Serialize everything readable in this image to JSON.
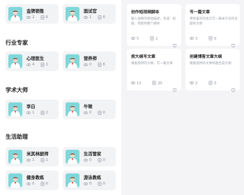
{
  "left": {
    "rows": [
      {
        "section": "",
        "cards": [
          {
            "name": "金牌销售",
            "v1": "2",
            "v2": "6"
          },
          {
            "name": "面试官",
            "v1": "1",
            "v2": "6"
          }
        ]
      },
      {
        "section": "行业专家",
        "cards": [
          {
            "name": "心理医生",
            "v1": "4",
            "v2": "1"
          },
          {
            "name": "营养师",
            "v1": "0",
            "v2": "6"
          }
        ]
      },
      {
        "section": "学术大师",
        "cards": [
          {
            "name": "李白",
            "v1": "1",
            "v2": "2"
          },
          {
            "name": "牛顿",
            "v1": "0",
            "v2": "0"
          }
        ]
      },
      {
        "section": "生活助理",
        "cards": [
          {
            "name": "米其林厨师",
            "v1": "1",
            "v2": "1"
          },
          {
            "name": "生活管家",
            "v1": "0",
            "v2": "0"
          },
          {
            "name": "健身教练",
            "v1": "0",
            "v2": "0"
          },
          {
            "name": "游泳教练",
            "v1": "0",
            "v2": "0"
          }
        ]
      }
    ]
  },
  "right": {
    "cards": [
      {
        "title": "创作短视频脚本",
        "desc": "输入视频的简短描述，生成：标题、场景和整个脚本",
        "views": "5",
        "comments": "1"
      },
      {
        "title": "写一篇文章",
        "desc": "用你喜欢的语言写一篇关于任何主题的文章",
        "views": "3",
        "comments": "0"
      },
      {
        "title": "按大纲写文章",
        "desc": "根据提供的大纲，写一篇文章",
        "views": "13",
        "comments": "20"
      },
      {
        "title": "创建博客文章大纲",
        "desc": "根据提供的文章标题生成大纲",
        "views": "2",
        "comments": "0"
      }
    ]
  },
  "colors": {
    "avatar_bg": "#7fd7d9",
    "card_bg": "#f2f3f5",
    "right_bg": "#f4f4f6"
  }
}
